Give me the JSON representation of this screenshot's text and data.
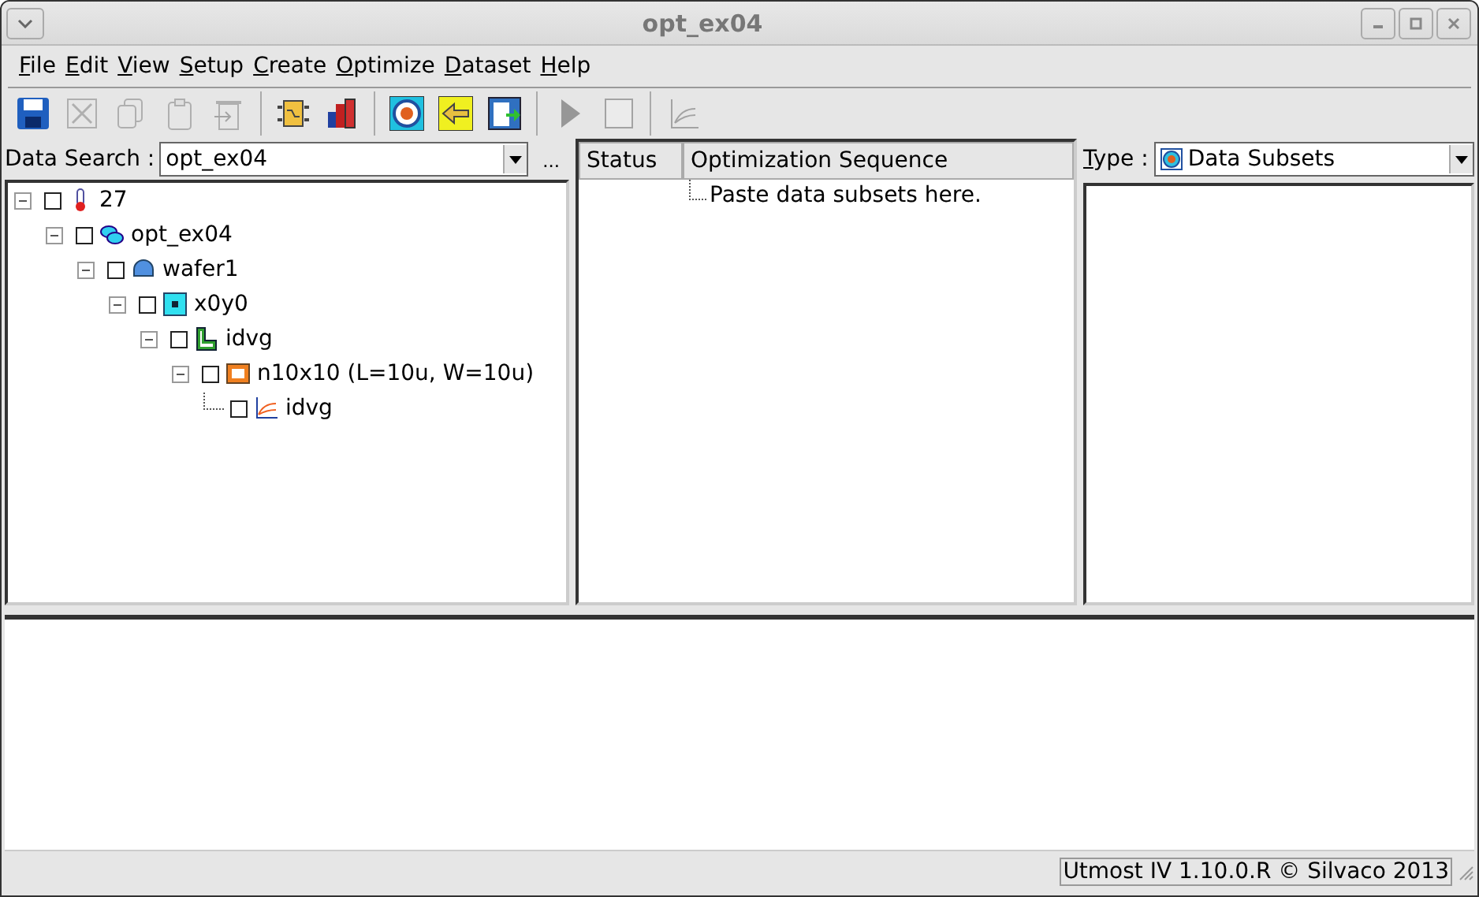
{
  "window": {
    "title": "opt_ex04"
  },
  "menu": [
    "File",
    "Edit",
    "View",
    "Setup",
    "Create",
    "Optimize",
    "Dataset",
    "Help"
  ],
  "toolbar": [
    [
      {
        "kind": "save",
        "disabled": false
      },
      {
        "kind": "cut",
        "disabled": true
      },
      {
        "kind": "copy",
        "disabled": true
      },
      {
        "kind": "paste",
        "disabled": true
      },
      {
        "kind": "delete",
        "disabled": true
      }
    ],
    [
      {
        "kind": "module",
        "disabled": false
      },
      {
        "kind": "books",
        "disabled": false
      }
    ],
    [
      {
        "kind": "target",
        "disabled": false
      },
      {
        "kind": "arrow",
        "disabled": false
      },
      {
        "kind": "calculator",
        "disabled": false
      }
    ],
    [
      {
        "kind": "play",
        "disabled": true
      },
      {
        "kind": "stop",
        "disabled": true
      }
    ],
    [
      {
        "kind": "chart",
        "disabled": true
      }
    ]
  ],
  "search": {
    "label": "Data Search :",
    "value": "opt_ex04",
    "more": "..."
  },
  "tree": [
    {
      "label": "27",
      "kind": "thermometer",
      "checked": false,
      "expanded": true,
      "children": [
        {
          "label": "opt_ex04",
          "kind": "capsule",
          "checked": false,
          "expanded": true,
          "children": [
            {
              "label": "wafer1",
              "kind": "wafer",
              "checked": false,
              "expanded": true,
              "children": [
                {
                  "label": "x0y0",
                  "kind": "die",
                  "checked": false,
                  "expanded": true,
                  "children": [
                    {
                      "label": "idvg",
                      "kind": "lshape",
                      "checked": false,
                      "expanded": true,
                      "children": [
                        {
                          "label": "n10x10 (L=10u, W=10u)",
                          "kind": "device",
                          "checked": false,
                          "expanded": true,
                          "children": [
                            {
                              "label": "idvg",
                              "kind": "curve",
                              "checked": false
                            }
                          ]
                        }
                      ]
                    }
                  ]
                }
              ]
            }
          ]
        }
      ]
    }
  ],
  "sequence": {
    "columns": [
      "Status",
      "Optimization Sequence"
    ],
    "hint": "Paste data subsets here."
  },
  "type_selector": {
    "label": "Type :",
    "value": "Data Subsets"
  },
  "status_bar": "Utmost IV 1.10.0.R © Silvaco 2013"
}
